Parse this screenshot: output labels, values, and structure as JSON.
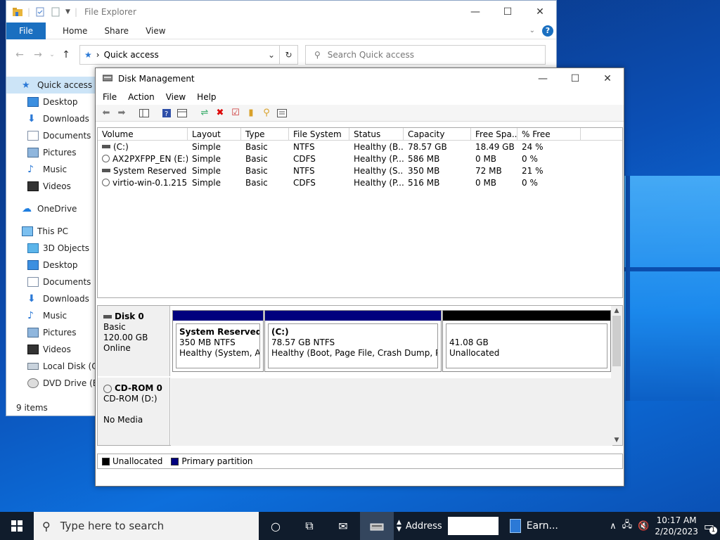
{
  "explorer": {
    "title": "File Explorer",
    "ribbon": {
      "file": "File",
      "tabs": [
        "Home",
        "Share",
        "View"
      ]
    },
    "address": "Quick access",
    "search_placeholder": "Search Quick access",
    "sidebar": [
      {
        "label": "Quick access",
        "icon": "star-icon"
      },
      {
        "label": "Desktop",
        "icon": "desktop-icon"
      },
      {
        "label": "Downloads",
        "icon": "downloads-icon"
      },
      {
        "label": "Documents",
        "icon": "documents-icon"
      },
      {
        "label": "Pictures",
        "icon": "pictures-icon"
      },
      {
        "label": "Music",
        "icon": "music-icon"
      },
      {
        "label": "Videos",
        "icon": "videos-icon"
      },
      {
        "label": "OneDrive",
        "icon": "cloud-icon"
      },
      {
        "label": "This PC",
        "icon": "computer-icon"
      },
      {
        "label": "3D Objects",
        "icon": "cube-icon"
      },
      {
        "label": "Desktop",
        "icon": "desktop-icon"
      },
      {
        "label": "Documents",
        "icon": "documents-icon"
      },
      {
        "label": "Downloads",
        "icon": "downloads-icon"
      },
      {
        "label": "Music",
        "icon": "music-icon"
      },
      {
        "label": "Pictures",
        "icon": "pictures-icon"
      },
      {
        "label": "Videos",
        "icon": "videos-icon"
      },
      {
        "label": "Local Disk (C:)",
        "icon": "drive-icon"
      },
      {
        "label": "DVD Drive (E:)",
        "icon": "dvd-icon"
      }
    ],
    "status": "9 items"
  },
  "dm": {
    "title": "Disk Management",
    "menu": [
      "File",
      "Action",
      "View",
      "Help"
    ],
    "columns": [
      "Volume",
      "Layout",
      "Type",
      "File System",
      "Status",
      "Capacity",
      "Free Spa...",
      "% Free"
    ],
    "rows": [
      [
        "(C:)",
        "Simple",
        "Basic",
        "NTFS",
        "Healthy (B...",
        "78.57 GB",
        "18.49 GB",
        "24 %"
      ],
      [
        "AX2PXFPP_EN (E:)",
        "Simple",
        "Basic",
        "CDFS",
        "Healthy (P...",
        "586 MB",
        "0 MB",
        "0 %"
      ],
      [
        "System Reserved",
        "Simple",
        "Basic",
        "NTFS",
        "Healthy (S...",
        "350 MB",
        "72 MB",
        "21 %"
      ],
      [
        "virtio-win-0.1.215 ...",
        "Simple",
        "Basic",
        "CDFS",
        "Healthy (P...",
        "516 MB",
        "0 MB",
        "0 %"
      ]
    ],
    "disk0": {
      "name": "Disk 0",
      "type": "Basic",
      "size": "120.00 GB",
      "state": "Online",
      "parts": [
        {
          "name": "System Reserved",
          "size": "350 MB NTFS",
          "status": "Healthy (System, Active, Primary Partition)"
        },
        {
          "name": "(C:)",
          "size": "78.57 GB NTFS",
          "status": "Healthy (Boot, Page File, Crash Dump, Primary Partition)"
        },
        {
          "size": "41.08 GB",
          "status": "Unallocated"
        }
      ]
    },
    "cdrom": {
      "name": "CD-ROM 0",
      "drive": "CD-ROM (D:)",
      "media": "No Media"
    },
    "legend": {
      "unallocated": "Unallocated",
      "primary": "Primary partition"
    },
    "colors": {
      "primary": "#00007e",
      "unallocated": "#000000"
    }
  },
  "taskbar": {
    "search_placeholder": "Type here to search",
    "address_label": "Address",
    "earn_label": "Earn...",
    "time": "10:17 AM",
    "date": "2/20/2023",
    "notifications": "1"
  }
}
